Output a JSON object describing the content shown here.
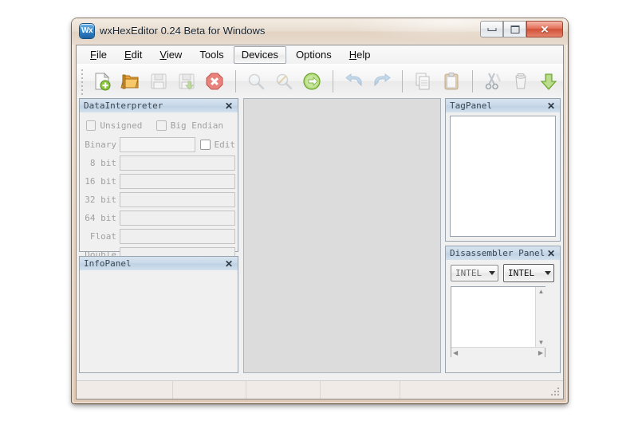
{
  "window": {
    "title": "wxHexEditor 0.24 Beta for Windows",
    "app_icon": "wx-app-icon",
    "caption_buttons": [
      {
        "name": "minimize-button",
        "label": "–"
      },
      {
        "name": "maximize-button",
        "label": "□"
      },
      {
        "name": "close-button",
        "label": "✕"
      }
    ]
  },
  "menubar": {
    "items": [
      {
        "name": "menu-file",
        "label": "File",
        "mnemonic": "F",
        "active": false
      },
      {
        "name": "menu-edit",
        "label": "Edit",
        "mnemonic": "E",
        "active": false
      },
      {
        "name": "menu-view",
        "label": "View",
        "mnemonic": "V",
        "active": false
      },
      {
        "name": "menu-tools",
        "label": "Tools",
        "mnemonic": "",
        "active": false
      },
      {
        "name": "menu-devices",
        "label": "Devices",
        "mnemonic": "",
        "active": true
      },
      {
        "name": "menu-options",
        "label": "Options",
        "mnemonic": "",
        "active": false
      },
      {
        "name": "menu-help",
        "label": "Help",
        "mnemonic": "H",
        "active": false
      }
    ]
  },
  "toolbar": {
    "gripper": "toolbar-gripper",
    "buttons": [
      {
        "name": "new-file-button",
        "icon": "new-document-icon",
        "enabled": true
      },
      {
        "name": "open-file-button",
        "icon": "open-folder-icon",
        "enabled": true
      },
      {
        "name": "save-button",
        "icon": "save-floppy-icon",
        "enabled": false
      },
      {
        "name": "save-as-button",
        "icon": "save-as-icon",
        "enabled": false
      },
      {
        "name": "close-file-button",
        "icon": "close-octagon-icon",
        "enabled": true
      },
      {
        "name": "find-button",
        "icon": "magnifier-icon",
        "enabled": false
      },
      {
        "name": "replace-button",
        "icon": "magnifier-pencil-icon",
        "enabled": false
      },
      {
        "name": "goto-button",
        "icon": "goto-arrow-icon",
        "enabled": true
      },
      {
        "name": "undo-button",
        "icon": "undo-arrow-icon",
        "enabled": false
      },
      {
        "name": "redo-button",
        "icon": "redo-arrow-icon",
        "enabled": false
      },
      {
        "name": "copy-button",
        "icon": "copy-pages-icon",
        "enabled": false
      },
      {
        "name": "paste-button",
        "icon": "clipboard-icon",
        "enabled": false
      },
      {
        "name": "cut-button",
        "icon": "scissors-icon",
        "enabled": false
      },
      {
        "name": "delete-button",
        "icon": "trash-can-icon",
        "enabled": false
      },
      {
        "name": "insert-button",
        "icon": "green-down-arrow-icon",
        "enabled": true
      }
    ]
  },
  "data_interpreter": {
    "title": "DataInterpreter",
    "close_label": "✕",
    "checkboxes": [
      {
        "name": "unsigned-checkbox",
        "label": "Unsigned",
        "checked": false,
        "enabled": false
      },
      {
        "name": "big-endian-checkbox",
        "label": "Big Endian",
        "checked": false,
        "enabled": false
      }
    ],
    "binary_label": "Binary",
    "binary_value": "",
    "edit_checkbox_label": "Edit",
    "edit_checked": false,
    "fields": [
      {
        "name": "field-8-bit",
        "label": "8 bit",
        "value": ""
      },
      {
        "name": "field-16-bit",
        "label": "16 bit",
        "value": ""
      },
      {
        "name": "field-32-bit",
        "label": "32 bit",
        "value": ""
      },
      {
        "name": "field-64-bit",
        "label": "64 bit",
        "value": ""
      },
      {
        "name": "field-float",
        "label": "Float",
        "value": ""
      },
      {
        "name": "field-double",
        "label": "Double",
        "value": ""
      }
    ]
  },
  "info_panel": {
    "title": "InfoPanel",
    "close_label": "✕",
    "content": ""
  },
  "tag_panel": {
    "title": "TagPanel",
    "close_label": "✕",
    "content": ""
  },
  "disassembler_panel": {
    "title": "Disassembler Panel",
    "close_label": "✕",
    "arch_select": {
      "name": "arch-dropdown",
      "value": "INTEL",
      "focused": false
    },
    "syntax_select": {
      "name": "syntax-dropdown",
      "value": "INTEL",
      "focused": true
    },
    "content": "",
    "scroll_up": "▲",
    "scroll_down": "▼",
    "scroll_left": "◀",
    "scroll_right": "▶"
  },
  "editor": {
    "name": "hex-editor-area",
    "content": ""
  },
  "statusbar": {
    "fields": [
      "",
      "",
      "",
      "",
      ""
    ],
    "grip": "resize-grip"
  },
  "colors": {
    "frame": "#ddc8b4",
    "client": "#f0f0f0",
    "panel_title": "#c9d9e9",
    "editor_bg": "#dcdcdc",
    "close_button": "#d15138",
    "accent_green": "#7cb342",
    "accent_blue": "#2f7fc4"
  }
}
